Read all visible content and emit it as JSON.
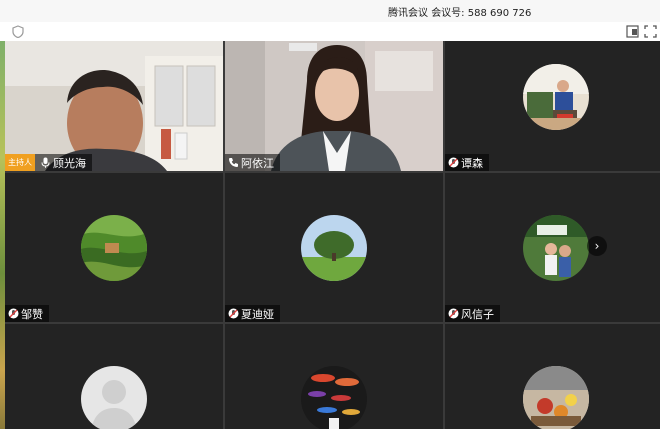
{
  "window": {
    "title": "腾讯会议",
    "meeting_id_label": "会议号:",
    "meeting_id": "588 690 726"
  },
  "participants": [
    {
      "name": "顾光海",
      "host_label": "主持人",
      "status_icon": "microphone-icon"
    },
    {
      "name": "阿依江",
      "status_icon": "phone-icon"
    },
    {
      "name": "谭森",
      "status_icon": "muted-microphone-icon"
    },
    {
      "name": "邹赞",
      "status_icon": "muted-microphone-icon"
    },
    {
      "name": "夏迪娅",
      "status_icon": "muted-microphone-icon"
    },
    {
      "name": "风信子",
      "status_icon": "muted-microphone-icon"
    },
    {
      "name": "",
      "status_icon": "default-avatar-icon"
    },
    {
      "name": "",
      "status_icon": ""
    },
    {
      "name": "",
      "status_icon": ""
    }
  ],
  "controls": {
    "next_page": "›"
  },
  "colors": {
    "host_badge": "#f0a020",
    "tile_bg": "#232323",
    "grid_gap": "#3a3a3a"
  }
}
